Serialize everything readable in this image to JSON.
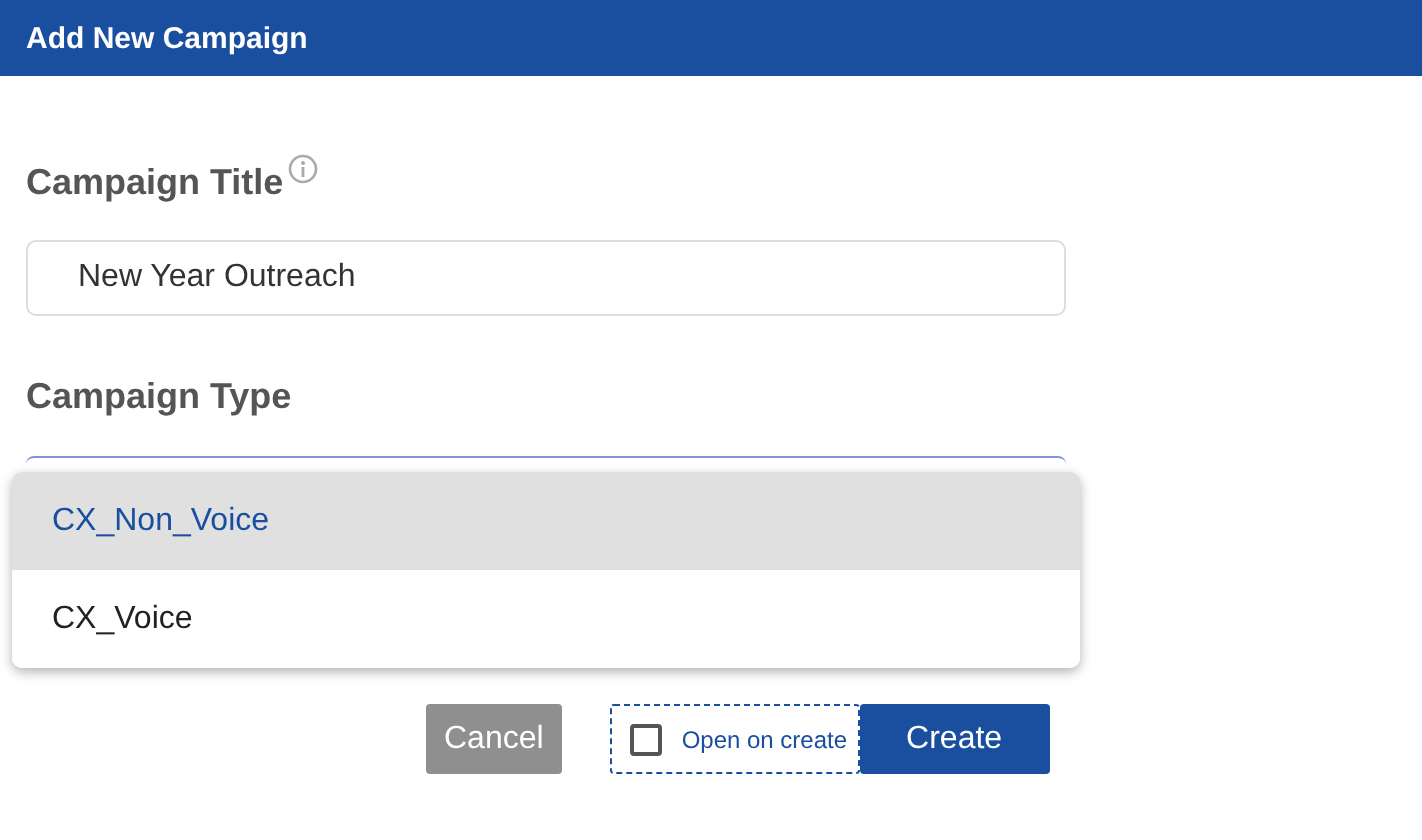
{
  "header": {
    "title": "Add New Campaign"
  },
  "campaign_title": {
    "label": "Campaign Title",
    "value": "New Year Outreach"
  },
  "campaign_type": {
    "label": "Campaign Type",
    "expanded": true,
    "options": [
      {
        "label": "CX_Non_Voice",
        "selected": true
      },
      {
        "label": "CX_Voice",
        "selected": false
      }
    ]
  },
  "open_on_create": {
    "label": "Open on create",
    "checked": false
  },
  "buttons": [
    {
      "label": "Cancel",
      "kind": "secondary"
    },
    {
      "label": "Create",
      "kind": "primary"
    }
  ]
}
